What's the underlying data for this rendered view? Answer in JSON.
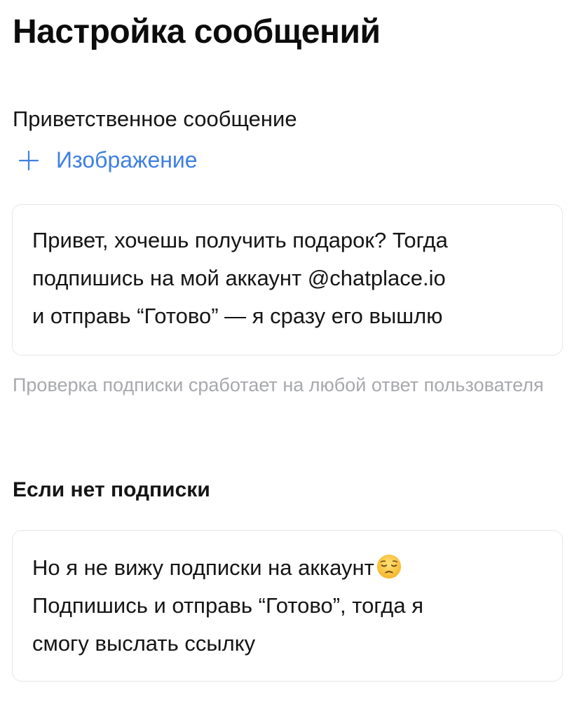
{
  "page": {
    "title": "Настройка сообщений"
  },
  "greeting": {
    "title": "Приветственное сообщение",
    "add_image_label": "Изображение",
    "message": "Привет, хочешь получить подарок? Тогда\nподпишись на мой аккаунт @chatplace.io\nи отправь “Готово” — я сразу его вышлю",
    "hint": "Проверка подписки сработает на любой ответ пользователя"
  },
  "no_subscription": {
    "title": "Если нет подписки",
    "message_line1": "Но я не вижу подписки на аккаунт",
    "message_rest": "Подпишись и отправь “Готово”, тогда я\nсмогу выслать ссылку",
    "emoji_icon": "pensive-face-icon"
  },
  "colors": {
    "accent": "#3f80e2",
    "hint": "#a8a9ad",
    "border": "#e6e7ea"
  }
}
